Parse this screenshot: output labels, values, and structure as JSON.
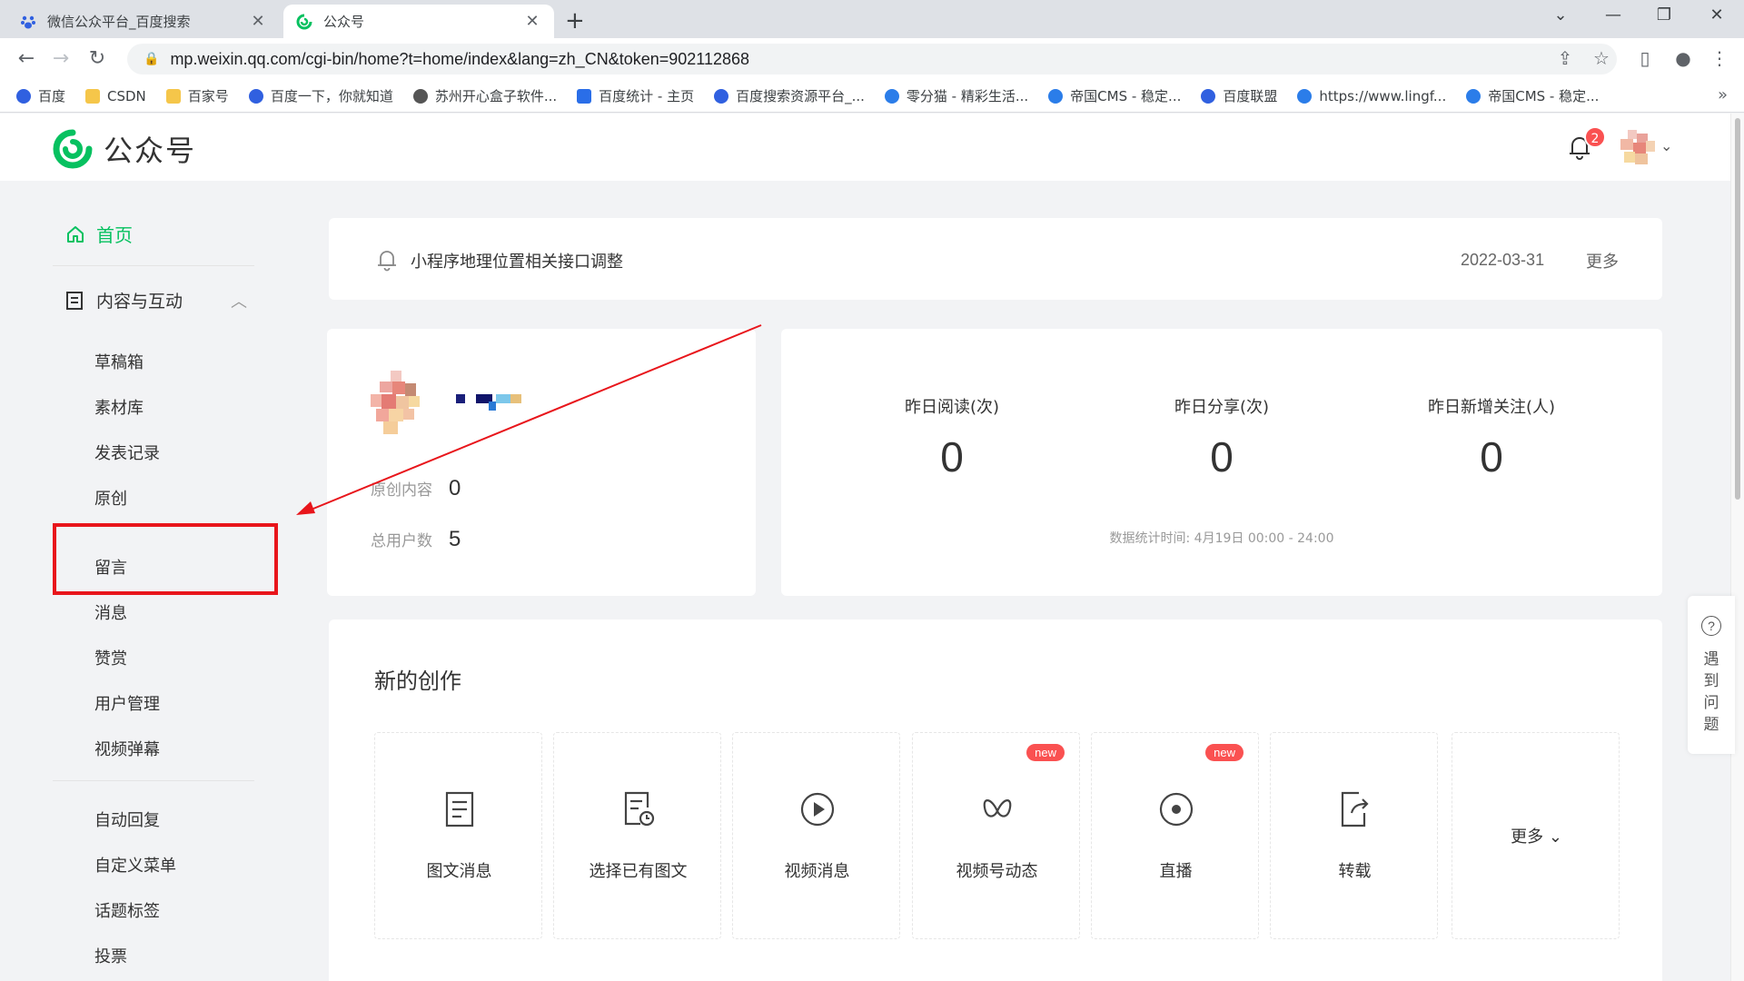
{
  "browser": {
    "tabs": [
      {
        "title": "微信公众平台_百度搜索",
        "active": false
      },
      {
        "title": "公众号",
        "active": true
      }
    ],
    "url": "mp.weixin.qq.com/cgi-bin/home?t=home/index&lang=zh_CN&token=902112868",
    "bookmarks": [
      {
        "label": "百度",
        "icon": "baidu-paw-icon"
      },
      {
        "label": "CSDN",
        "icon": "folder-icon"
      },
      {
        "label": "百家号",
        "icon": "folder-icon"
      },
      {
        "label": "百度一下，你就知道",
        "icon": "baidu-paw-icon"
      },
      {
        "label": "苏州开心盒子软件...",
        "icon": "globe-icon"
      },
      {
        "label": "百度统计 - 主页",
        "icon": "baidu-stats-icon"
      },
      {
        "label": "百度搜索资源平台_...",
        "icon": "baidu-paw-icon"
      },
      {
        "label": "零分猫 - 精彩生活...",
        "icon": "site-icon"
      },
      {
        "label": "帝国CMS - 稳定...",
        "icon": "site-icon"
      },
      {
        "label": "百度联盟",
        "icon": "baidu-paw-icon"
      },
      {
        "label": "https://www.lingf...",
        "icon": "site-icon"
      },
      {
        "label": "帝国CMS - 稳定...",
        "icon": "site-icon"
      }
    ]
  },
  "header": {
    "logo_text": "公众号",
    "notification_count": "2"
  },
  "sidebar": {
    "home": "首页",
    "group": "内容与互动",
    "items": [
      "草稿箱",
      "素材库",
      "发表记录",
      "原创",
      "留言",
      "消息",
      "赞赏",
      "用户管理",
      "视频弹幕"
    ],
    "items2": [
      "自动回复",
      "自定义菜单",
      "话题标签",
      "投票"
    ]
  },
  "notice": {
    "text": "小程序地理位置相关接口调整",
    "date": "2022-03-31",
    "more": "更多"
  },
  "account": {
    "original_label": "原创内容",
    "original_value": "0",
    "users_label": "总用户数",
    "users_value": "5"
  },
  "stats": {
    "items": [
      {
        "label": "昨日阅读(次)",
        "value": "0"
      },
      {
        "label": "昨日分享(次)",
        "value": "0"
      },
      {
        "label": "昨日新增关注(人)",
        "value": "0"
      }
    ],
    "time": "数据统计时间: 4月19日 00:00 - 24:00"
  },
  "create": {
    "title": "新的创作",
    "tiles": [
      {
        "label": "图文消息",
        "icon": "article-icon",
        "badge": ""
      },
      {
        "label": "选择已有图文",
        "icon": "article-history-icon",
        "badge": ""
      },
      {
        "label": "视频消息",
        "icon": "play-circle-icon",
        "badge": ""
      },
      {
        "label": "视频号动态",
        "icon": "channels-icon",
        "badge": "new"
      },
      {
        "label": "直播",
        "icon": "live-icon",
        "badge": "new"
      },
      {
        "label": "转载",
        "icon": "repost-icon",
        "badge": ""
      }
    ],
    "more": "更多"
  },
  "help": {
    "text": "遇到问题"
  },
  "colors": {
    "brand_green": "#07c160",
    "highlight_red": "#e8151b",
    "badge_red": "#fa5151"
  }
}
